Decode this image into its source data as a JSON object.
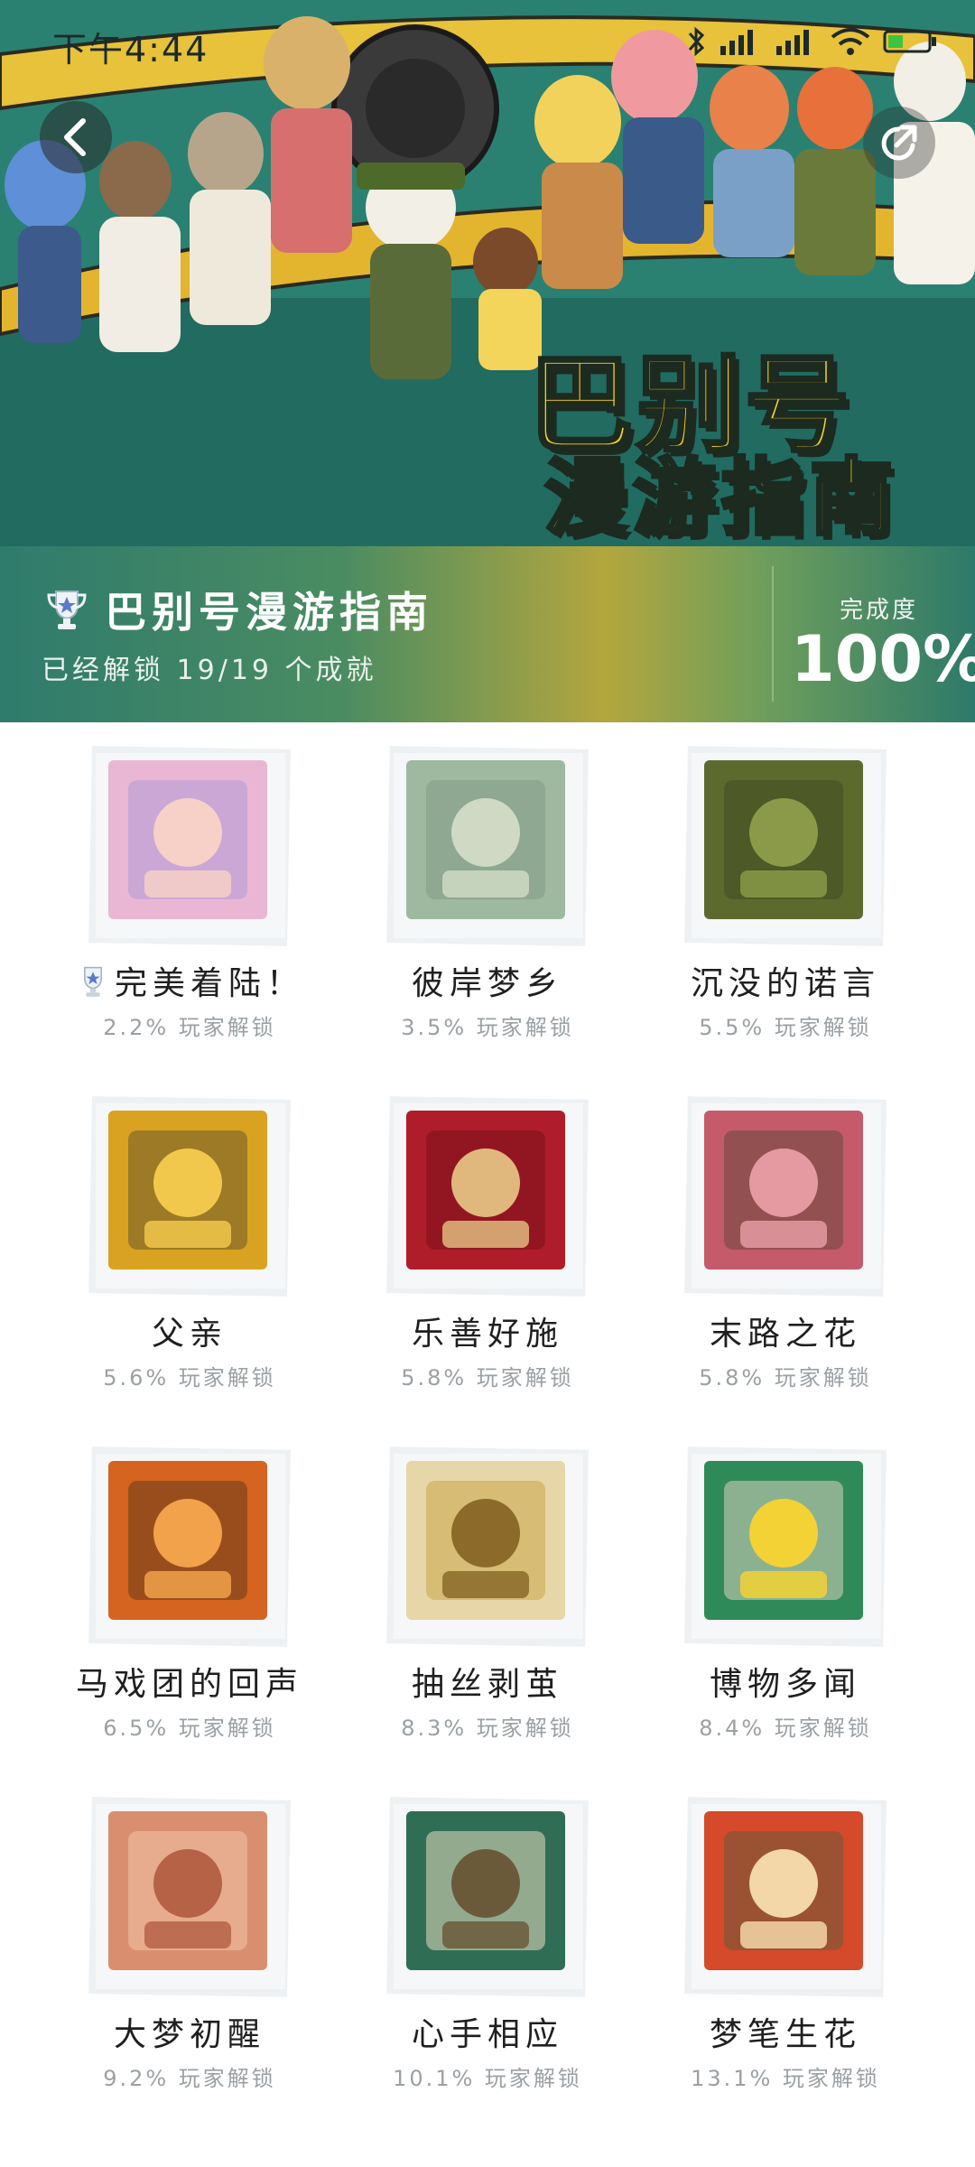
{
  "status_bar": {
    "time": "下午4:44"
  },
  "hero": {
    "logo_line1": "巴别号",
    "logo_line2": "漫游指南"
  },
  "info": {
    "title": "巴别号漫游指南",
    "subtitle": "已经解锁 19/19 个成就",
    "completion_label": "完成度",
    "completion_value": "100%"
  },
  "achievements": [
    {
      "title": "完美着陆！",
      "pct": "2.2% 玩家解锁",
      "trophy": true,
      "colors": [
        "#e9b7d4",
        "#f7d0c7",
        "#b39ad6"
      ]
    },
    {
      "title": "彼岸梦乡",
      "pct": "3.5% 玩家解锁",
      "trophy": false,
      "colors": [
        "#9fb8a0",
        "#cfd9c3",
        "#7f9b86"
      ]
    },
    {
      "title": "沉没的诺言",
      "pct": "5.5% 玩家解锁",
      "trophy": false,
      "colors": [
        "#5d6a2d",
        "#8a9a48",
        "#3f4a22"
      ]
    },
    {
      "title": "父亲",
      "pct": "5.6% 玩家解锁",
      "trophy": false,
      "colors": [
        "#d9a221",
        "#f1c84b",
        "#6a5a2b"
      ]
    },
    {
      "title": "乐善好施",
      "pct": "5.8% 玩家解锁",
      "trophy": false,
      "colors": [
        "#b01d2a",
        "#e0b87e",
        "#7a1119"
      ]
    },
    {
      "title": "末路之花",
      "pct": "5.8% 玩家解锁",
      "trophy": false,
      "colors": [
        "#c45a6a",
        "#e59aa2",
        "#6a4a3a"
      ]
    },
    {
      "title": "马戏团的回声",
      "pct": "6.5% 玩家解锁",
      "trophy": false,
      "colors": [
        "#d46420",
        "#f1a24a",
        "#6a3a1a"
      ]
    },
    {
      "title": "抽丝剥茧",
      "pct": "8.3% 玩家解锁",
      "trophy": false,
      "colors": [
        "#e6d6a8",
        "#8b6a2a",
        "#c9a74a"
      ]
    },
    {
      "title": "博物多闻",
      "pct": "8.4% 玩家解锁",
      "trophy": false,
      "colors": [
        "#2f8a5a",
        "#f2d234",
        "#d8d2c0"
      ]
    },
    {
      "title": "大梦初醒",
      "pct": "9.2% 玩家解锁",
      "trophy": false,
      "colors": [
        "#d98f6f",
        "#b56246",
        "#f2c3a6"
      ]
    },
    {
      "title": "心手相应",
      "pct": "10.1% 玩家解锁",
      "trophy": false,
      "colors": [
        "#2f6e54",
        "#6b5a3a",
        "#e6dcc0"
      ]
    },
    {
      "title": "梦笔生花",
      "pct": "13.1% 玩家解锁",
      "trophy": false,
      "colors": [
        "#d44a2a",
        "#f3d7a8",
        "#6b5a3a"
      ]
    }
  ],
  "colors": {
    "accent": "#f6d21e",
    "hero_bg": "#2e8878"
  }
}
